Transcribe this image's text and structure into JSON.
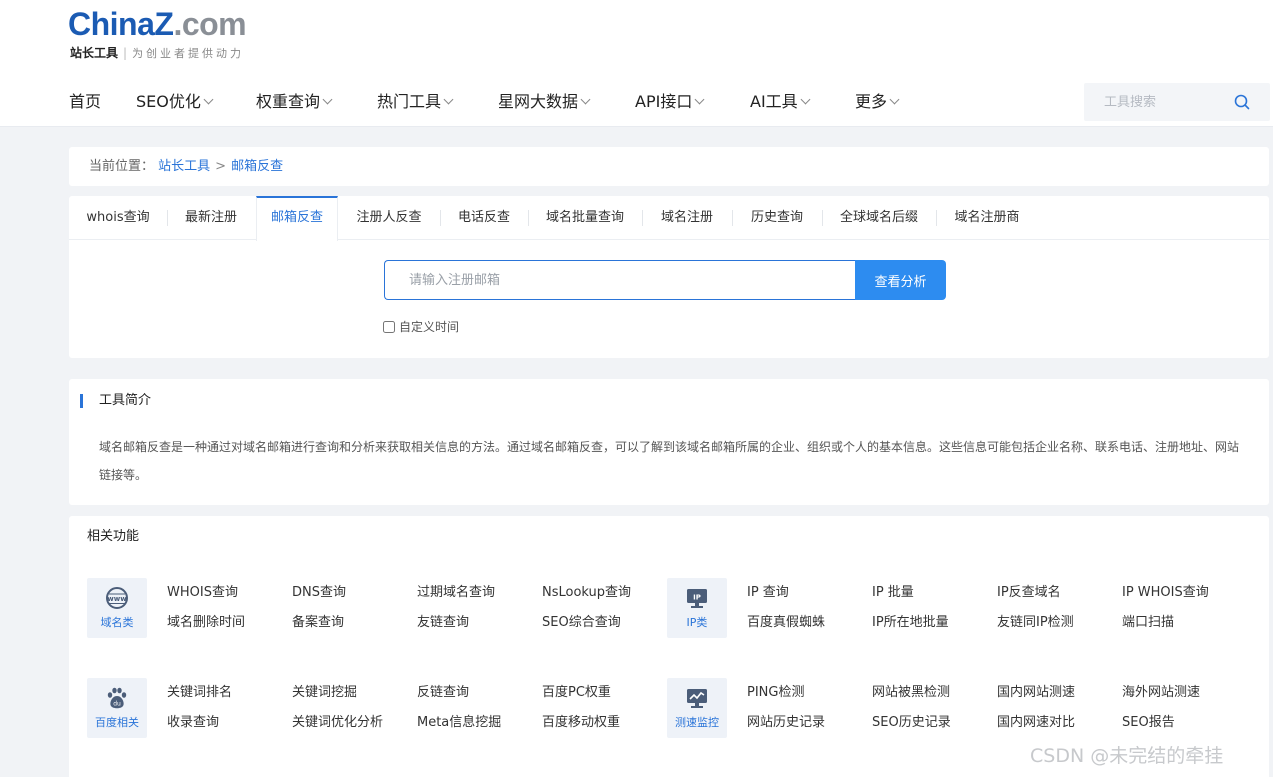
{
  "logo": {
    "part1": "China",
    "part2": "Z",
    "part3": ".com",
    "name": "站长工具",
    "divider": "|",
    "slogan": "为创业者提供动力"
  },
  "nav": [
    {
      "label": "首页",
      "has_dropdown": false
    },
    {
      "label": "SEO优化",
      "has_dropdown": true
    },
    {
      "label": "权重查询",
      "has_dropdown": true
    },
    {
      "label": "热门工具",
      "has_dropdown": true
    },
    {
      "label": "星网大数据",
      "has_dropdown": true
    },
    {
      "label": "API接口",
      "has_dropdown": true
    },
    {
      "label": "AI工具",
      "has_dropdown": true
    },
    {
      "label": "更多",
      "has_dropdown": true
    }
  ],
  "search": {
    "placeholder": "工具搜索",
    "icon": "search-icon"
  },
  "breadcrumb": {
    "label": "当前位置：",
    "home": "站长工具",
    "separator": ">",
    "current": "邮箱反查"
  },
  "tabs": [
    {
      "label": "whois查询",
      "active": false
    },
    {
      "label": "最新注册",
      "active": false
    },
    {
      "label": "邮箱反查",
      "active": true
    },
    {
      "label": "注册人反查",
      "active": false
    },
    {
      "label": "电话反查",
      "active": false
    },
    {
      "label": "域名批量查询",
      "active": false
    },
    {
      "label": "域名注册",
      "active": false
    },
    {
      "label": "历史查询",
      "active": false
    },
    {
      "label": "全球域名后缀",
      "active": false
    },
    {
      "label": "域名注册商",
      "active": false
    }
  ],
  "query": {
    "placeholder": "请输入注册邮箱",
    "value": "",
    "button": "查看分析",
    "checkbox_label": "自定义时间",
    "checkbox_checked": false
  },
  "intro": {
    "title": "工具简介",
    "text": "域名邮箱反查是一种通过对域名邮箱进行查询和分析来获取相关信息的方法。通过域名邮箱反查，可以了解到该域名邮箱所属的企业、组织或个人的基本信息。这些信息可能包括企业名称、联系电话、注册地址、网站链接等。"
  },
  "related": {
    "title": "相关功能",
    "groups": [
      {
        "category": "域名类",
        "icon": "globe-www-icon",
        "links": [
          "WHOIS查询",
          "DNS查询",
          "过期域名查询",
          "NsLookup查询",
          "域名删除时间",
          "备案查询",
          "友链查询",
          "SEO综合查询"
        ]
      },
      {
        "category": "IP类",
        "icon": "monitor-ip-icon",
        "links": [
          "IP 查询",
          "IP 批量",
          "IP反查域名",
          "IP WHOIS查询",
          "百度真假蜘蛛",
          "IP所在地批量",
          "友链同IP检测",
          "端口扫描"
        ]
      },
      {
        "category": "百度相关",
        "icon": "baidu-paw-icon",
        "links": [
          "关键词排名",
          "关键词挖掘",
          "反链查询",
          "百度PC权重",
          "收录查询",
          "关键词优化分析",
          "Meta信息挖掘",
          "百度移动权重"
        ]
      },
      {
        "category": "测速监控",
        "icon": "monitor-chart-icon",
        "links": [
          "PING检测",
          "网站被黑检测",
          "国内网站测速",
          "海外网站测速",
          "网站历史记录",
          "SEO历史记录",
          "国内网速对比",
          "SEO报告"
        ]
      }
    ]
  },
  "watermark": "CSDN @未完结的牵挂",
  "colors": {
    "accent": "#2a74d8",
    "button": "#2d8cf0",
    "logo_blue": "#1b5bb3",
    "logo_gray": "#8a8f96",
    "page_bg": "#f1f3f6"
  }
}
